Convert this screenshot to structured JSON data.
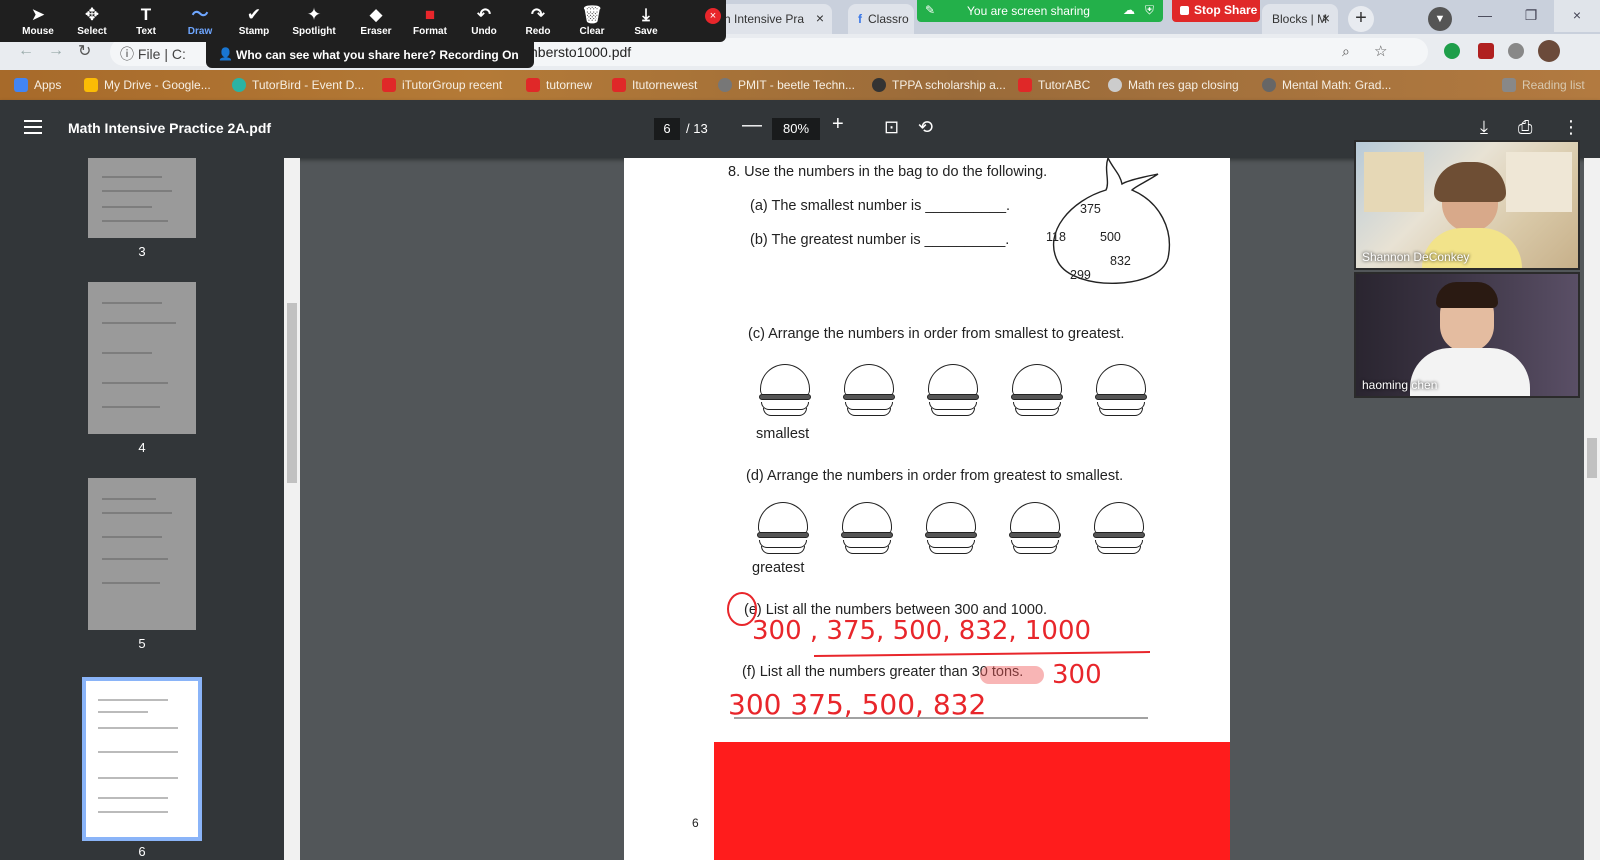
{
  "browser": {
    "tabs": [
      {
        "label": "ath Intensive Pra",
        "close": "×"
      },
      {
        "label": "Classro"
      },
      {
        "label": "Blocks | M",
        "close": "×"
      }
    ],
    "new_tab": "+",
    "address": {
      "scheme": "File",
      "url_fragment": "C:",
      "url": "nbersto1000.pdf"
    },
    "window_min": "—",
    "window_max": "❐",
    "window_close": "×"
  },
  "bookmarks": [
    {
      "label": "Apps",
      "color": "#4285f4"
    },
    {
      "label": "My Drive - Google...",
      "color": "#fbbc05"
    },
    {
      "label": "TutorBird - Event D...",
      "color": "#2bb3a3"
    },
    {
      "label": "iTutorGroup recent",
      "color": "#e02828"
    },
    {
      "label": "tutornew",
      "color": "#e02828"
    },
    {
      "label": "Itutornewest",
      "color": "#e02828"
    },
    {
      "label": "PMIT - beetle Techn...",
      "color": "#777777"
    },
    {
      "label": "TPPA scholarship a...",
      "color": "#333333"
    },
    {
      "label": "TutorABC",
      "color": "#e02828"
    },
    {
      "label": "Math res gap closing",
      "color": "#cccccc"
    },
    {
      "label": "Mental Math: Grad...",
      "color": "#666666"
    },
    {
      "label": "Reading list",
      "color": "#888888"
    }
  ],
  "zoom_toolbar": {
    "tools": [
      {
        "label": "Mouse",
        "glyph": "➤"
      },
      {
        "label": "Select",
        "glyph": "✥"
      },
      {
        "label": "Text",
        "glyph": "T"
      },
      {
        "label": "Draw",
        "glyph": "〜"
      },
      {
        "label": "Stamp",
        "glyph": "✔"
      },
      {
        "label": "Spotlight",
        "glyph": "✦"
      },
      {
        "label": "Eraser",
        "glyph": "◆"
      },
      {
        "label": "Format",
        "glyph": "■"
      },
      {
        "label": "Undo",
        "glyph": "↶"
      },
      {
        "label": "Redo",
        "glyph": "↷"
      },
      {
        "label": "Clear",
        "glyph": "🗑"
      },
      {
        "label": "Save",
        "glyph": "⤓"
      }
    ],
    "close": "×",
    "sharing_banner": "You are screen sharing",
    "stop_share": "Stop Share",
    "recording_tip": "Who can see what you share here? Recording On"
  },
  "pdf_viewer": {
    "title": "Math Intensive Practice 2A.pdf",
    "page_current": "6",
    "page_total": "/ 13",
    "zoom_out": "—",
    "zoom": "80%",
    "zoom_in": "+",
    "thumbnails": [
      "3",
      "4",
      "5",
      "6"
    ]
  },
  "page": {
    "q8": "8.   Use the numbers in the bag to do the following.",
    "qa": "(a)   The smallest number is __________.",
    "qb": "(b)   The greatest number is __________.",
    "bag_numbers": [
      "375",
      "118",
      "500",
      "832",
      "299"
    ],
    "qc": "(c)   Arrange the numbers in order from smallest to greatest.",
    "label_smallest": "smallest",
    "qd": "(d)   Arrange the numbers in order from greatest to smallest.",
    "label_greatest": "greatest",
    "qe": "(e)   List all the numbers between 300 and 1000.",
    "qf": "(f)   List all the numbers greater than 30 tons.",
    "page_number": "6",
    "handwriting": {
      "e_answer": "300 , 375, 500, 832, 1000",
      "f_side": "300",
      "f_answer": "300   375, 500, 832"
    }
  },
  "participants": [
    {
      "name": "Shannon DeConkey"
    },
    {
      "name": "haoming   chen"
    }
  ]
}
